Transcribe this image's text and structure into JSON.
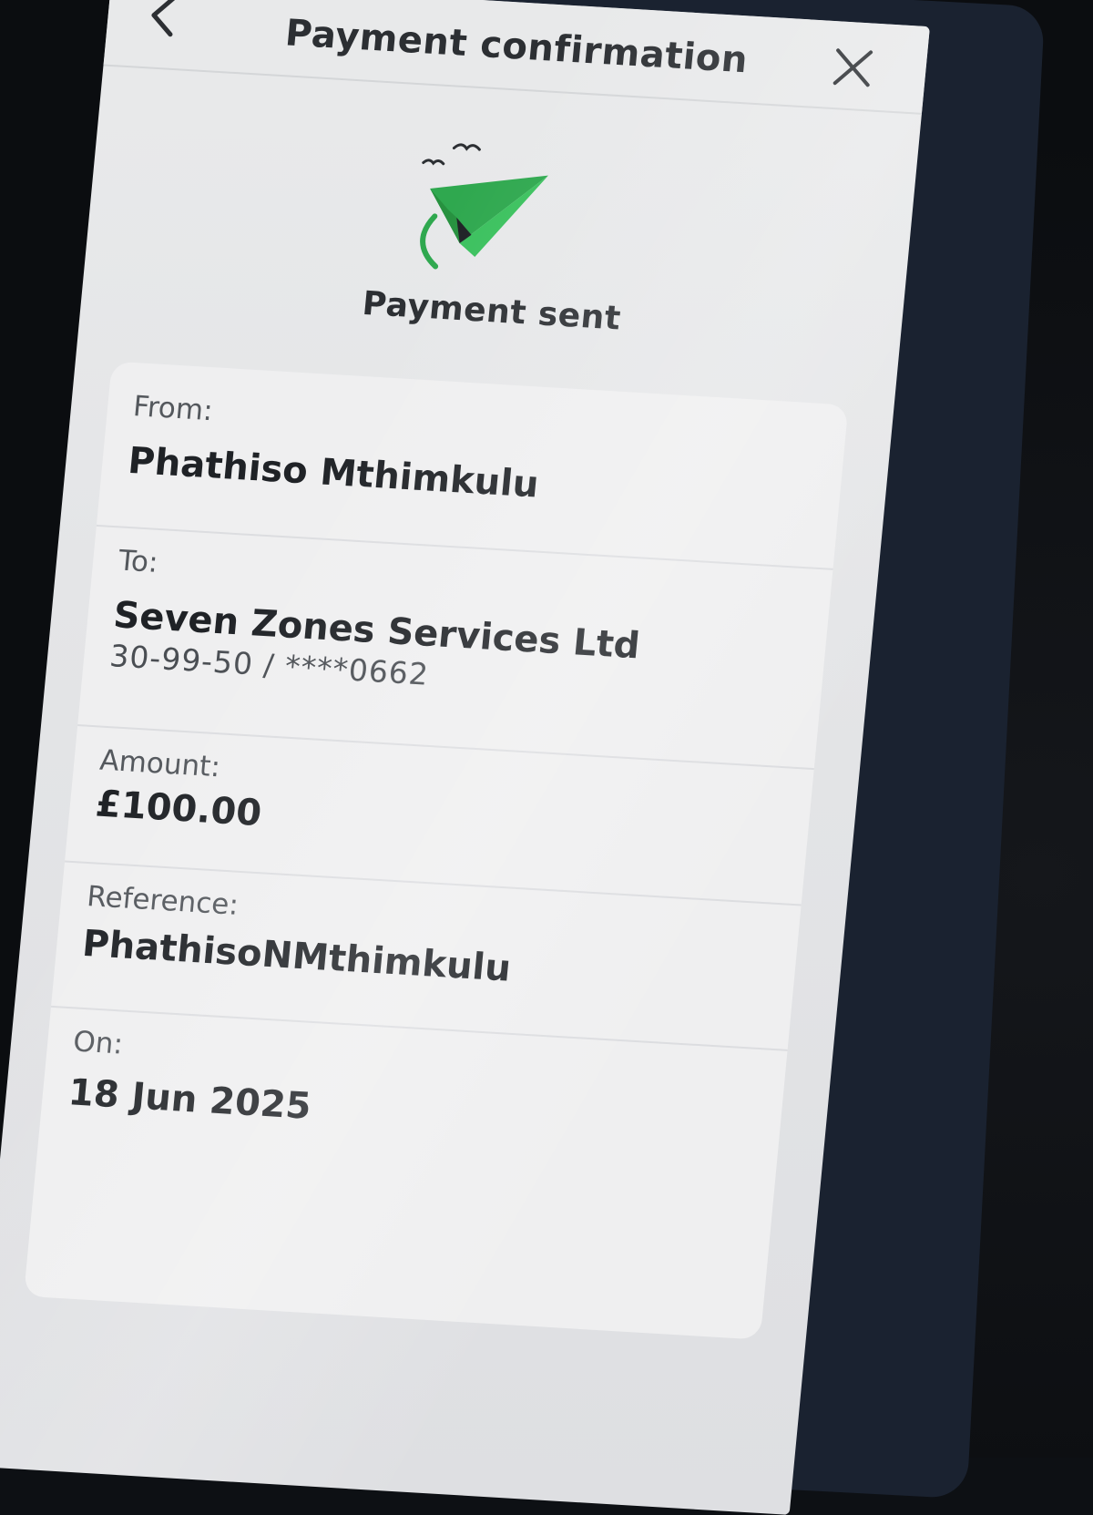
{
  "header": {
    "title": "Payment confirmation",
    "back_icon": "chevron-left-icon",
    "close_icon": "close-icon"
  },
  "hero": {
    "icon": "paper-plane-icon",
    "status": "Payment sent",
    "accent_color": "#2fa84f"
  },
  "details": {
    "from_label": "From:",
    "from_value": "Phathiso Mthimkulu",
    "to_label": "To:",
    "to_value": "Seven Zones Services Ltd",
    "to_account": "30-99-50 / ****0662",
    "amount_label": "Amount:",
    "amount_value": "£100.00",
    "reference_label": "Reference:",
    "reference_value": "PhathisoNMthimkulu",
    "date_label": "On:",
    "date_value": "18 Jun 2025"
  }
}
